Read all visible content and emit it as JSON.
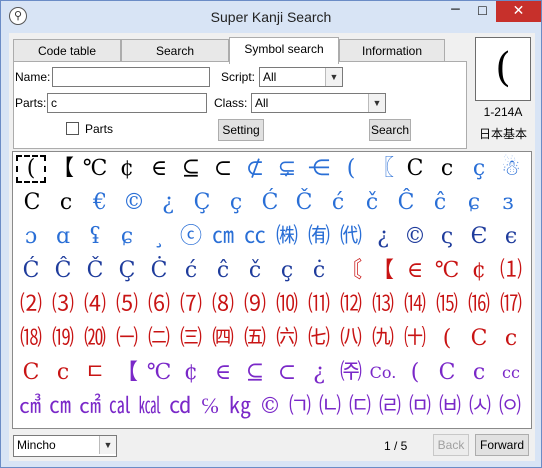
{
  "window": {
    "title": "Super Kanji Search",
    "min": "─",
    "max": "☐",
    "close": "✕"
  },
  "tabs": [
    "Code table",
    "Search",
    "Symbol search",
    "Information"
  ],
  "form": {
    "name_label": "Name:",
    "name_value": "",
    "script_label": "Script:",
    "script_value": "All",
    "parts_label": "Parts:",
    "parts_value": "c",
    "class_label": "Class:",
    "class_value": "All",
    "parts_checkbox_label": "Parts",
    "setting_button": "Setting",
    "search_button": "Search"
  },
  "preview": {
    "glyph": "(",
    "code": "1-214A",
    "charset": "日本基本"
  },
  "grid": {
    "rows": [
      [
        {
          "c": "(",
          "k": "#000000"
        },
        {
          "c": "【",
          "k": "#000000"
        },
        {
          "c": "℃",
          "k": "#000000"
        },
        {
          "c": "¢",
          "k": "#000000"
        },
        {
          "c": "∈",
          "k": "#000000"
        },
        {
          "c": "⊆",
          "k": "#000000"
        },
        {
          "c": "⊂",
          "k": "#000000"
        },
        {
          "c": "⊄",
          "k": "#2a6fd6"
        },
        {
          "c": "⊊",
          "k": "#2a6fd6"
        },
        {
          "c": "⋲",
          "k": "#2a6fd6"
        },
        {
          "c": "(",
          "k": "#2a6fd6"
        },
        {
          "c": "〖",
          "k": "#2a6fd6"
        },
        {
          "c": "C",
          "k": "#000000"
        },
        {
          "c": "c",
          "k": "#000000"
        },
        {
          "c": "ç",
          "k": "#2a6fd6"
        },
        {
          "c": "☃",
          "k": "#2a6fd6"
        }
      ],
      [
        {
          "c": "C",
          "k": "#000000"
        },
        {
          "c": "c",
          "k": "#000000"
        },
        {
          "c": "€",
          "k": "#2a6fd6"
        },
        {
          "c": "©",
          "k": "#2a6fd6"
        },
        {
          "c": "¿",
          "k": "#2a6fd6"
        },
        {
          "c": "Ç",
          "k": "#2a6fd6"
        },
        {
          "c": "ç",
          "k": "#2a6fd6"
        },
        {
          "c": "Ć",
          "k": "#2a6fd6"
        },
        {
          "c": "Č",
          "k": "#2a6fd6"
        },
        {
          "c": "ć",
          "k": "#2a6fd6"
        },
        {
          "c": "č",
          "k": "#2a6fd6"
        },
        {
          "c": "Ĉ",
          "k": "#2a6fd6"
        },
        {
          "c": "ĉ",
          "k": "#2a6fd6"
        },
        {
          "c": "ɕ",
          "k": "#2a6fd6"
        },
        {
          "c": "ɜ",
          "k": "#2a6fd6"
        }
      ],
      [
        {
          "c": "ɔ",
          "k": "#2a6fd6"
        },
        {
          "c": "ɑ",
          "k": "#2a6fd6"
        },
        {
          "c": "ʢ",
          "k": "#2a6fd6"
        },
        {
          "c": "ɕ",
          "k": "#2a6fd6"
        },
        {
          "c": "¸",
          "k": "#2a6fd6"
        },
        {
          "c": "ⓒ",
          "k": "#2a6fd6"
        },
        {
          "c": "㎝",
          "k": "#2a6fd6"
        },
        {
          "c": "㏄",
          "k": "#2a6fd6"
        },
        {
          "c": "㈱",
          "k": "#2a6fd6"
        },
        {
          "c": "㈲",
          "k": "#2a6fd6"
        },
        {
          "c": "㈹",
          "k": "#2a6fd6"
        },
        {
          "c": "¿",
          "k": "#1f3c9c"
        },
        {
          "c": "©",
          "k": "#1f3c9c"
        },
        {
          "c": "ς",
          "k": "#1f3c9c"
        },
        {
          "c": "Є",
          "k": "#1f3c9c"
        },
        {
          "c": "є",
          "k": "#1f3c9c"
        }
      ],
      [
        {
          "c": "Ć",
          "k": "#1f3c9c"
        },
        {
          "c": "Ĉ",
          "k": "#1f3c9c"
        },
        {
          "c": "Č",
          "k": "#1f3c9c"
        },
        {
          "c": "Ç",
          "k": "#1f3c9c"
        },
        {
          "c": "Ċ",
          "k": "#1f3c9c"
        },
        {
          "c": "ć",
          "k": "#1f3c9c"
        },
        {
          "c": "ĉ",
          "k": "#1f3c9c"
        },
        {
          "c": "č",
          "k": "#1f3c9c"
        },
        {
          "c": "ç",
          "k": "#1f3c9c"
        },
        {
          "c": "ċ",
          "k": "#1f3c9c"
        },
        {
          "c": "〘",
          "k": "#c81414"
        },
        {
          "c": "【",
          "k": "#c81414"
        },
        {
          "c": "∈",
          "k": "#c81414"
        },
        {
          "c": "℃",
          "k": "#c81414"
        },
        {
          "c": "¢",
          "k": "#c81414"
        },
        {
          "c": "⑴",
          "k": "#c81414"
        }
      ],
      [
        {
          "c": "⑵",
          "k": "#c81414"
        },
        {
          "c": "⑶",
          "k": "#c81414"
        },
        {
          "c": "⑷",
          "k": "#c81414"
        },
        {
          "c": "⑸",
          "k": "#c81414"
        },
        {
          "c": "⑹",
          "k": "#c81414"
        },
        {
          "c": "⑺",
          "k": "#c81414"
        },
        {
          "c": "⑻",
          "k": "#c81414"
        },
        {
          "c": "⑼",
          "k": "#c81414"
        },
        {
          "c": "⑽",
          "k": "#c81414"
        },
        {
          "c": "⑾",
          "k": "#c81414"
        },
        {
          "c": "⑿",
          "k": "#c81414"
        },
        {
          "c": "⒀",
          "k": "#c81414"
        },
        {
          "c": "⒁",
          "k": "#c81414"
        },
        {
          "c": "⒂",
          "k": "#c81414"
        },
        {
          "c": "⒃",
          "k": "#c81414"
        },
        {
          "c": "⒄",
          "k": "#c81414"
        }
      ],
      [
        {
          "c": "⒅",
          "k": "#c81414"
        },
        {
          "c": "⒆",
          "k": "#c81414"
        },
        {
          "c": "⒇",
          "k": "#c81414"
        },
        {
          "c": "㈠",
          "k": "#c81414"
        },
        {
          "c": "㈡",
          "k": "#c81414"
        },
        {
          "c": "㈢",
          "k": "#c81414"
        },
        {
          "c": "㈣",
          "k": "#c81414"
        },
        {
          "c": "㈤",
          "k": "#c81414"
        },
        {
          "c": "㈥",
          "k": "#c81414"
        },
        {
          "c": "㈦",
          "k": "#c81414"
        },
        {
          "c": "㈧",
          "k": "#c81414"
        },
        {
          "c": "㈨",
          "k": "#c81414"
        },
        {
          "c": "㈩",
          "k": "#c81414"
        },
        {
          "c": "(",
          "k": "#c81414"
        },
        {
          "c": "C",
          "k": "#c81414"
        },
        {
          "c": "c",
          "k": "#c81414"
        }
      ],
      [
        {
          "c": "C",
          "k": "#c81414"
        },
        {
          "c": "c",
          "k": "#c81414"
        },
        {
          "c": "ㄷ",
          "k": "#c81414"
        },
        {
          "c": "【",
          "k": "#7a28c8"
        },
        {
          "c": "℃",
          "k": "#7a28c8"
        },
        {
          "c": "¢",
          "k": "#7a28c8"
        },
        {
          "c": "∈",
          "k": "#7a28c8"
        },
        {
          "c": "⊆",
          "k": "#7a28c8"
        },
        {
          "c": "⊂",
          "k": "#7a28c8"
        },
        {
          "c": "¿",
          "k": "#7a28c8"
        },
        {
          "c": "㈜",
          "k": "#7a28c8"
        },
        {
          "c": "Co.",
          "k": "#7a28c8"
        },
        {
          "c": "(",
          "k": "#7a28c8"
        },
        {
          "c": "C",
          "k": "#7a28c8"
        },
        {
          "c": "c",
          "k": "#7a28c8"
        },
        {
          "c": "cc",
          "k": "#7a28c8"
        }
      ],
      [
        {
          "c": "㎤",
          "k": "#7a28c8"
        },
        {
          "c": "㎝",
          "k": "#7a28c8"
        },
        {
          "c": "㎠",
          "k": "#7a28c8"
        },
        {
          "c": "㎈",
          "k": "#7a28c8"
        },
        {
          "c": "㎉",
          "k": "#7a28c8"
        },
        {
          "c": "㏅",
          "k": "#7a28c8"
        },
        {
          "c": "℅",
          "k": "#7a28c8"
        },
        {
          "c": "㎏",
          "k": "#7a28c8"
        },
        {
          "c": "©",
          "k": "#7a28c8"
        },
        {
          "c": "㈀",
          "k": "#7a28c8"
        },
        {
          "c": "㈁",
          "k": "#7a28c8"
        },
        {
          "c": "㈂",
          "k": "#7a28c8"
        },
        {
          "c": "㈃",
          "k": "#7a28c8"
        },
        {
          "c": "㈄",
          "k": "#7a28c8"
        },
        {
          "c": "㈅",
          "k": "#7a28c8"
        },
        {
          "c": "㈆",
          "k": "#7a28c8"
        },
        {
          "c": "㈇",
          "k": "#7a28c8"
        }
      ]
    ]
  },
  "footer": {
    "font_value": "Mincho",
    "page_indicator": "1 / 5",
    "back_button": "Back",
    "forward_button": "Forward"
  }
}
